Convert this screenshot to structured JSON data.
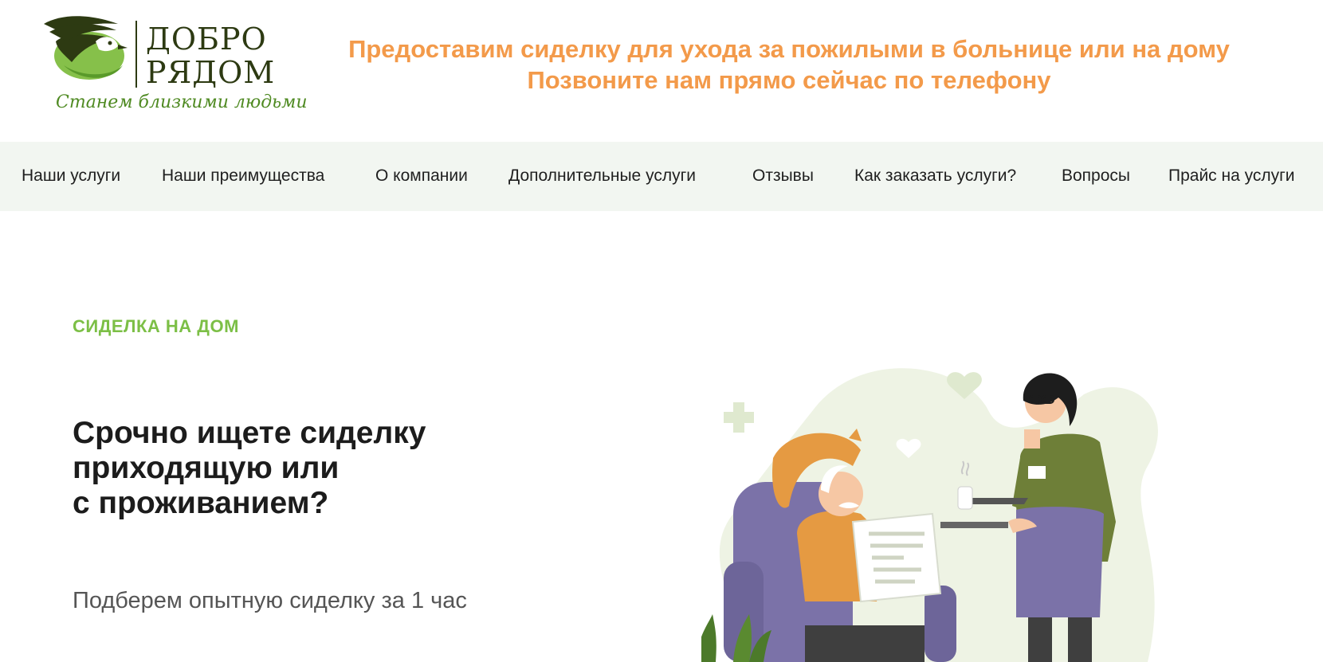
{
  "header": {
    "logo": {
      "word1": "ДОБРО",
      "word2": "РЯДОМ",
      "tagline": "Станем близкими людьми"
    },
    "promo_line1": "Предоставим сиделку для ухода за пожилыми в больнице или на дому",
    "promo_line2": "Позвоните нам прямо сейчас по телефону"
  },
  "nav": {
    "items": [
      {
        "label": "Наши услуги"
      },
      {
        "label": "Наши преимущества"
      },
      {
        "label": "О компании"
      },
      {
        "label": "Дополнительные услуги"
      },
      {
        "label": "Отзывы"
      },
      {
        "label": "Как заказать услуги?"
      },
      {
        "label": "Вопросы"
      },
      {
        "label": "Прайс на услуги"
      }
    ]
  },
  "hero": {
    "eyebrow": "СИДЕЛКА НА ДОМ",
    "title_lines": [
      "Срочно ищете сиделку",
      "приходящую или",
      "с проживанием?"
    ],
    "subtitle": "Подберем опытную сиделку за 1 час",
    "illustration": {
      "icon": "caregiver-serving-elderly-man-illustration",
      "badge_text": "ДОБРО РЯДОМ"
    }
  },
  "colors": {
    "accent_orange": "#f39a4a",
    "accent_green": "#7cbf46",
    "logo_dark": "#2d3a12",
    "nav_bg": "#f2f6f1",
    "text_dark": "#1c1c1c",
    "text_muted": "#555555"
  }
}
